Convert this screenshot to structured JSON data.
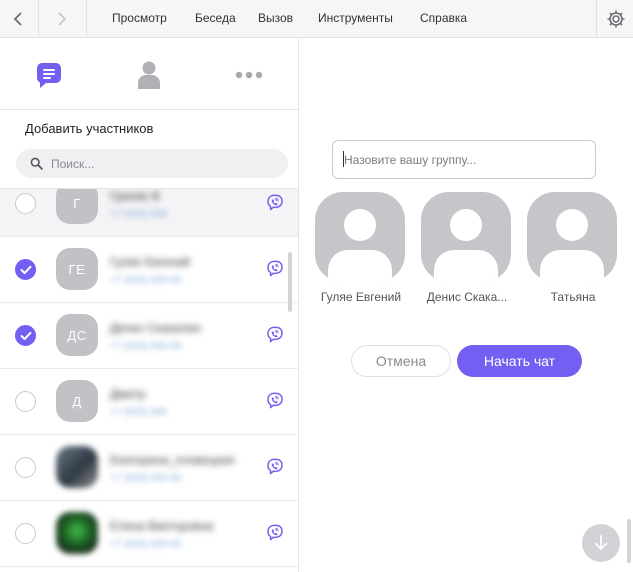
{
  "menu": {
    "items": [
      "Просмотр",
      "Беседа",
      "Вызов",
      "Инструменты",
      "Справка"
    ]
  },
  "icons": {
    "back": "chevron-left-icon",
    "forward": "chevron-right-icon",
    "settings": "gear-icon",
    "chats": "chat-bubble-icon",
    "contacts": "person-icon",
    "more": "more-dots-icon",
    "search": "search-icon",
    "viber": "viber-icon",
    "scroll_down": "arrow-down-icon"
  },
  "colors": {
    "accent": "#7360f2",
    "avatar_placeholder": "#c2c2c6",
    "divider": "#e3e3e6"
  },
  "sidebar": {
    "title": "Добавить участников",
    "search": {
      "placeholder": "Поиск...",
      "value": ""
    },
    "contacts": [
      {
        "initials": "Г",
        "name": "Гриняк Ф",
        "sub": "+7 (915) 000",
        "checked": false,
        "avatar": "initials"
      },
      {
        "initials": "ГЕ",
        "name": "Гуляе Евгений",
        "sub": "+7 (915) 000-00",
        "checked": true,
        "avatar": "initials"
      },
      {
        "initials": "ДС",
        "name": "Денис Скакалин",
        "sub": "+7 (915) 000-00",
        "checked": true,
        "avatar": "initials"
      },
      {
        "initials": "Д",
        "name": "Дмитр",
        "sub": "+7 (915) 000",
        "checked": false,
        "avatar": "initials"
      },
      {
        "initials": "",
        "name": "Екатерина_пловецкая",
        "sub": "+7 (915) 000-00",
        "checked": false,
        "avatar": "photo1"
      },
      {
        "initials": "",
        "name": "Елена Викторовна",
        "sub": "+7 (915) 000-00",
        "checked": false,
        "avatar": "photo2"
      }
    ]
  },
  "group": {
    "name_placeholder": "Назовите вашу группу...",
    "name_value": "",
    "members": [
      {
        "name": "Гуляе Евгений"
      },
      {
        "name": "Денис Скака..."
      },
      {
        "name": "Татьяна"
      }
    ],
    "cancel_label": "Отмена",
    "start_label": "Начать чат"
  }
}
